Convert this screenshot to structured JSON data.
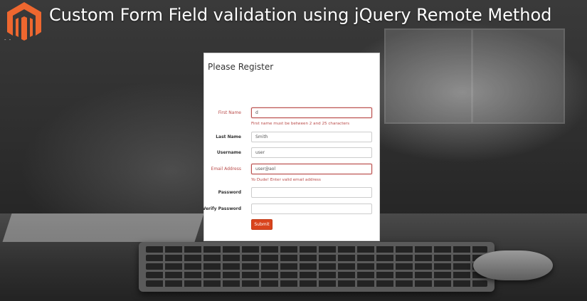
{
  "page": {
    "headline": "Custom Form Field validation using jQuery Remote Method",
    "logo_icon": "magento-logo-icon",
    "logo_dots": "- -",
    "accent_color": "#ee672f"
  },
  "form": {
    "title": "Please Register",
    "fields": [
      {
        "label": "First Name",
        "value": "d",
        "state": "error",
        "error_message": "First name must be between 2 and 25 characters"
      },
      {
        "label": "Last Name",
        "value": "Smith",
        "state": "normal"
      },
      {
        "label": "Username",
        "value": "user",
        "state": "normal"
      },
      {
        "label": "Email Address",
        "value": "user@aol",
        "state": "error",
        "error_message": "Yo Dude! Enter valid email address"
      },
      {
        "label": "Password",
        "value": "",
        "state": "normal"
      },
      {
        "label": "Verify Password",
        "value": "",
        "state": "normal"
      }
    ],
    "submit_label": "Submit",
    "colors": {
      "error": "#b94a48",
      "submit": "#d9441d"
    }
  }
}
